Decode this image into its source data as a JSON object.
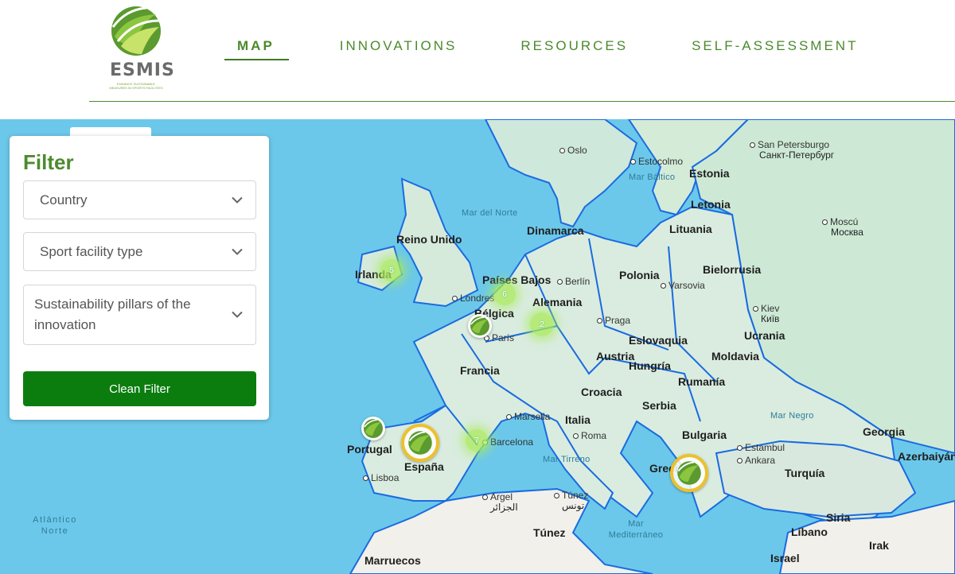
{
  "logo": {
    "word": "ESMIS",
    "tagline": "ENHANCE SUSTAINABLE MEASURES IN SPORTS FACILITIES"
  },
  "nav": [
    {
      "label": "MAP",
      "active": true
    },
    {
      "label": "INNOVATIONS",
      "active": false
    },
    {
      "label": "RESOURCES",
      "active": false
    },
    {
      "label": "SELF-ASSESSMENT",
      "active": false
    }
  ],
  "filter": {
    "title": "Filter",
    "country_placeholder": "Country",
    "facility_placeholder": "Sport facility type",
    "pillars_placeholder": "Sustainability pillars of the innovation",
    "clean_label": "Clean Filter"
  },
  "map": {
    "countries": [
      "Reino Unido",
      "Irlanda",
      "Países Bajos",
      "Bélgica",
      "Alemania",
      "Dinamarca",
      "Polonia",
      "Estonia",
      "Letonia",
      "Lituania",
      "Bielorrusia",
      "Ucrania",
      "Moldavia",
      "Eslovaquia",
      "Austria",
      "Hungría",
      "Rumanía",
      "Croacia",
      "Serbia",
      "Bulgaria",
      "Francia",
      "Italia",
      "España",
      "Portugal",
      "Grecia",
      "Turquía",
      "Georgia",
      "Azerbaiyán",
      "Siria",
      "Líbano",
      "Israel",
      "Irak",
      "Túnez",
      "Marruecos"
    ],
    "cities": [
      "Oslo",
      "Estocolmo",
      "San Petersburgo",
      "Санкт-Петербург",
      "Moscú",
      "Москва",
      "Kiev",
      "Київ",
      "Berlín",
      "Varsovia",
      "Praga",
      "Londres",
      "París",
      "Marsella",
      "Barcelona",
      "Roma",
      "Lisboa",
      "Estambul",
      "Ankara",
      "Argel",
      "الجزائر",
      "Túnez",
      "تونس"
    ],
    "seas": [
      "Mar del Norte",
      "Mar Báltico",
      "Mar Negro",
      "Mar Tirreno",
      "Mar Mediterráneo",
      "Atlántico Norte"
    ],
    "clusters": [
      "5",
      "6",
      "2",
      "7"
    ]
  },
  "colors": {
    "brand_green": "#4d8b2f",
    "button_green": "#0b7d0f",
    "border_blue": "#1a6be0",
    "sea": "#6cc8ea",
    "marker_ring": "#ecc12e"
  }
}
